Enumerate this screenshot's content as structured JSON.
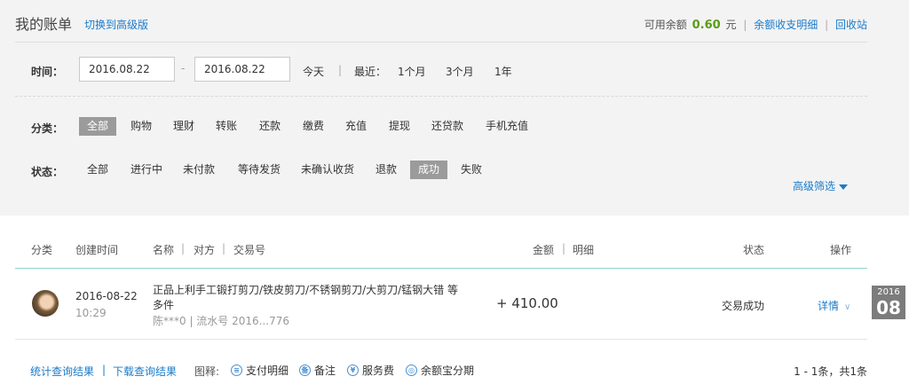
{
  "header": {
    "title": "我的账单",
    "switch_link": "切换到高级版",
    "balance_label": "可用余额",
    "balance_value": "0.60",
    "balance_unit": "元",
    "balance_detail_link": "余额收支明细",
    "sep": "|",
    "recycle_link": "回收站"
  },
  "time_filter": {
    "label": "时间：",
    "start_date": "2016.08.22",
    "dash": "-",
    "end_date": "2016.08.22",
    "today": "今天",
    "sep": "|",
    "recent_label": "最近：",
    "ranges": [
      "1个月",
      "3个月",
      "1年"
    ]
  },
  "category_filter": {
    "label": "分类：",
    "items": [
      "全部",
      "购物",
      "理财",
      "转账",
      "还款",
      "缴费",
      "充值",
      "提现",
      "还贷款",
      "手机充值"
    ],
    "active": "全部"
  },
  "status_filter": {
    "label": "状态：",
    "items": [
      "全部",
      "进行中",
      "未付款",
      "等待发货",
      "未确认收货",
      "退款",
      "成功",
      "失败"
    ],
    "active": "成功"
  },
  "advanced_filter": "高级筛选",
  "table": {
    "headers": {
      "category": "分类",
      "created": "创建时间",
      "name": "名称",
      "sep": "|",
      "counterparty": "对方",
      "trade_no": "交易号",
      "amount": "金额",
      "detail": "明细",
      "status": "状态",
      "action": "操作"
    },
    "rows": [
      {
        "date": "2016-08-22",
        "time": "10:29",
        "name": "正品上利手工锻打剪刀/铁皮剪刀/不锈钢剪刀/大剪刀/锰钢大错 等多件",
        "meta": "陈***0 | 流水号 2016...776",
        "amount": "+ 410.00",
        "status": "交易成功",
        "detail_link": "详情",
        "chevron": "∨"
      }
    ]
  },
  "date_badge": {
    "year": "2016",
    "month": "08"
  },
  "footer": {
    "stats_link": "统计查询结果",
    "sep": "|",
    "download_link": "下载查询结果",
    "legend_label": "图释:",
    "legend": [
      {
        "icon": "payment-detail-icon",
        "glyph": "≡",
        "label": "支付明细"
      },
      {
        "icon": "note-icon",
        "glyph": "备",
        "label": "备注"
      },
      {
        "icon": "service-fee-icon",
        "glyph": "¥",
        "label": "服务费"
      },
      {
        "icon": "yuebao-installment-icon",
        "glyph": "◎",
        "label": "余额宝分期"
      }
    ],
    "pager": "1 - 1条，共1条"
  }
}
